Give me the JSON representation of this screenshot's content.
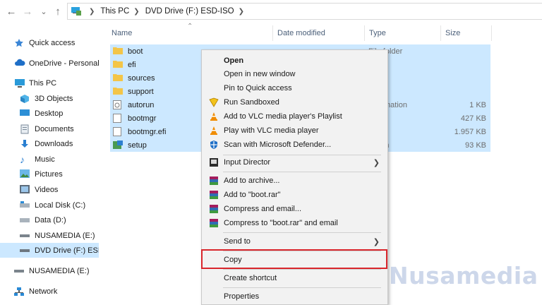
{
  "address": {
    "crumbs": [
      "This PC",
      "DVD Drive (F:) ESD-ISO"
    ]
  },
  "nav": {
    "items": [
      {
        "label": "Quick access",
        "icon": "star-icon"
      },
      {
        "label": "OneDrive - Personal",
        "icon": "cloud-icon"
      },
      {
        "label": "This PC",
        "icon": "pc-icon"
      },
      {
        "label": "3D Objects",
        "icon": "cube-icon"
      },
      {
        "label": "Desktop",
        "icon": "desktop-icon"
      },
      {
        "label": "Documents",
        "icon": "documents-icon"
      },
      {
        "label": "Downloads",
        "icon": "download-icon"
      },
      {
        "label": "Music",
        "icon": "music-icon"
      },
      {
        "label": "Pictures",
        "icon": "pictures-icon"
      },
      {
        "label": "Videos",
        "icon": "videos-icon"
      },
      {
        "label": "Local Disk (C:)",
        "icon": "disk-icon"
      },
      {
        "label": "Data (D:)",
        "icon": "disk-icon"
      },
      {
        "label": "NUSAMEDIA (E:)",
        "icon": "usb-drive-icon"
      },
      {
        "label": "DVD Drive (F:) ESD-ISO",
        "icon": "dvd-drive-icon"
      },
      {
        "label": "NUSAMEDIA (E:)",
        "icon": "usb-drive-icon"
      },
      {
        "label": "Network",
        "icon": "network-icon"
      }
    ]
  },
  "columns": {
    "name": "Name",
    "date": "Date modified",
    "type": "Type",
    "size": "Size"
  },
  "files": [
    {
      "name": "boot",
      "date": "",
      "type": "File folder",
      "size": "",
      "icon": "folder-icon"
    },
    {
      "name": "efi",
      "date": "",
      "type": "older",
      "size": "",
      "icon": "folder-icon"
    },
    {
      "name": "sources",
      "date": "",
      "type": "older",
      "size": "",
      "icon": "folder-icon"
    },
    {
      "name": "support",
      "date": "",
      "type": "older",
      "size": "",
      "icon": "folder-icon"
    },
    {
      "name": "autorun",
      "date": "",
      "type": "Information",
      "size": "1 KB",
      "icon": "setup-info-icon"
    },
    {
      "name": "bootmgr",
      "date": "",
      "type": "",
      "size": "427 KB",
      "icon": "file-icon"
    },
    {
      "name": "bootmgr.efi",
      "date": "",
      "type": "le",
      "size": "1.957 KB",
      "icon": "file-icon"
    },
    {
      "name": "setup",
      "date": "",
      "type": "cation",
      "size": "93 KB",
      "icon": "setup-app-icon"
    }
  ],
  "menu": {
    "open": "Open",
    "open_new_window": "Open in new window",
    "pin_quick_access": "Pin to Quick access",
    "run_sandboxed": "Run Sandboxed",
    "vlc_playlist": "Add to VLC media player's Playlist",
    "vlc_play": "Play with VLC media player",
    "defender_scan": "Scan with Microsoft Defender...",
    "input_director": "Input Director",
    "add_archive": "Add to archive...",
    "add_boot_rar": "Add to \"boot.rar\"",
    "compress_email": "Compress and email...",
    "compress_boot_email": "Compress to \"boot.rar\" and email",
    "send_to": "Send to",
    "copy": "Copy",
    "create_shortcut": "Create shortcut",
    "properties": "Properties"
  },
  "watermark": {
    "text": "Nusamedia"
  },
  "colors": {
    "selection": "#cce8ff",
    "highlight_box": "#d9262c",
    "folder": "#f3c548"
  }
}
